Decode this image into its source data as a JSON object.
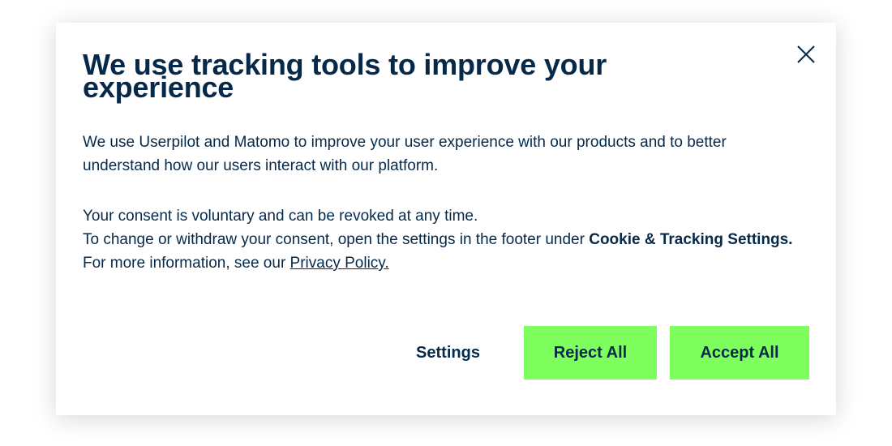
{
  "dialog": {
    "title": "We use tracking tools to improve your experience",
    "intro": "We use Userpilot and Matomo to improve your user experience with our products and to better understand how our users interact with our platform.",
    "consent_line": "Your consent is voluntary and can be revoked at any time.",
    "change_text": "To change or withdraw your consent, open the settings in the footer under ",
    "change_link_bold": "Cookie & Tracking Settings.",
    "more_info_text": "For more information, see our ",
    "privacy_link": "Privacy Policy.",
    "close_icon": "close-icon"
  },
  "buttons": {
    "settings": "Settings",
    "reject_all": "Reject All",
    "accept_all": "Accept All"
  },
  "colors": {
    "text": "#06294a",
    "accent_button": "#7eff5e",
    "background": "#ffffff"
  }
}
